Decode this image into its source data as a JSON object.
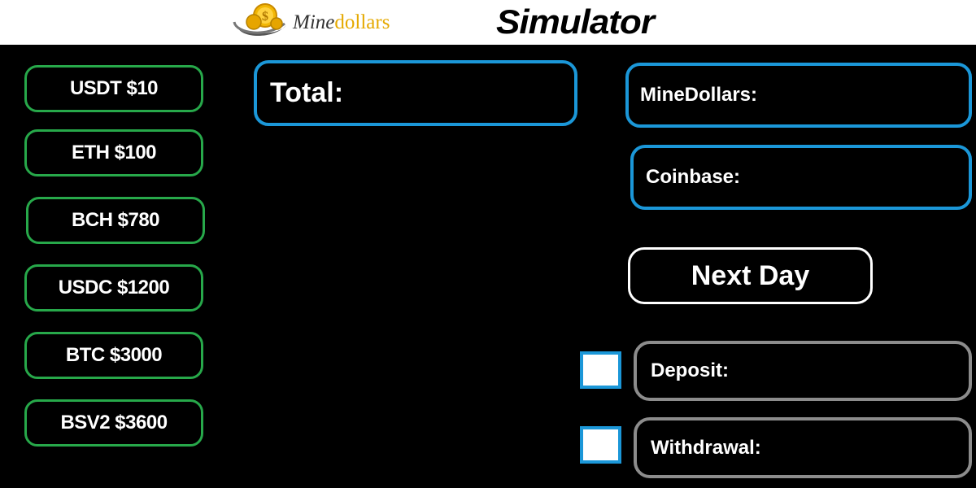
{
  "header": {
    "logo": {
      "mine": "Mine",
      "dollars": "dollars"
    },
    "title": "Simulator"
  },
  "coins": [
    {
      "label": "USDT $10"
    },
    {
      "label": "ETH $100"
    },
    {
      "label": "BCH $780"
    },
    {
      "label": "USDC $1200"
    },
    {
      "label": "BTC $3000"
    },
    {
      "label": "BSV2 $3600"
    }
  ],
  "panels": {
    "total": "Total:",
    "minedollars": "MineDollars:",
    "coinbase": "Coinbase:"
  },
  "next_day": "Next Day",
  "deposit": {
    "label": "Deposit:",
    "checked": false
  },
  "withdrawal": {
    "label": "Withdrawal:",
    "checked": false
  },
  "colors": {
    "background": "#000000",
    "header": "#ffffff",
    "coin_border": "#27a84a",
    "panel_border": "#1b97d8",
    "field_border": "#8c8c8c",
    "logo_gold": "#e5a900"
  },
  "icons": {
    "logo": "gold-dollar-coin-icon"
  }
}
